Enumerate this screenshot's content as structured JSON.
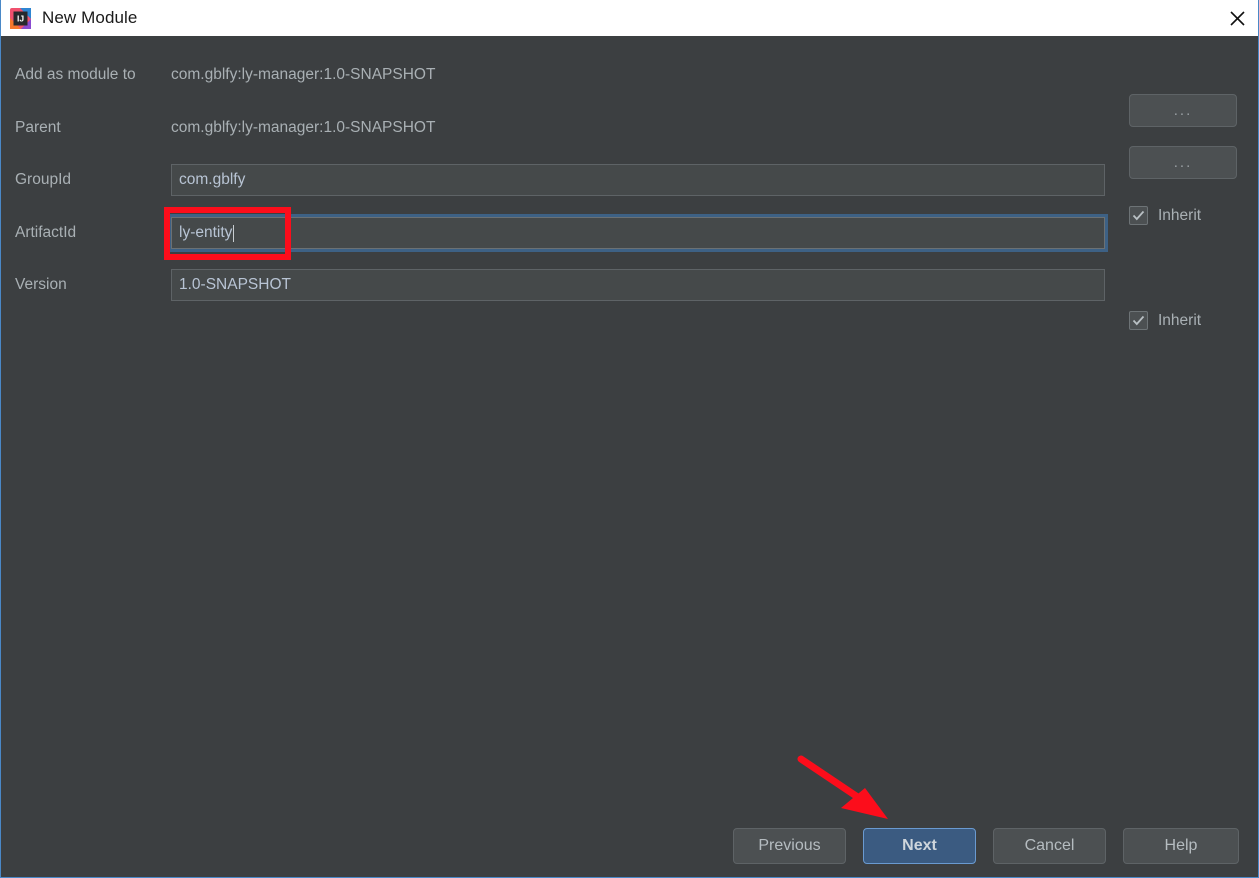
{
  "window": {
    "title": "New Module",
    "app_icon": "intellij-idea-logo-icon",
    "close_icon": "close-icon",
    "border_color": "#4a88c7",
    "background": "#3c3f41"
  },
  "form": {
    "rows": [
      {
        "label": "Add as module to",
        "type": "static",
        "value": "com.gblfy:ly-manager:1.0-SNAPSHOT"
      },
      {
        "label": "Parent",
        "type": "static",
        "value": "com.gblfy:ly-manager:1.0-SNAPSHOT"
      },
      {
        "label": "GroupId",
        "type": "input",
        "value": "com.gblfy"
      },
      {
        "label": "ArtifactId",
        "type": "input",
        "value": "ly-entity"
      },
      {
        "label": "Version",
        "type": "input",
        "value": "1.0-SNAPSHOT"
      }
    ],
    "browse_buttons": [
      {
        "label": "...",
        "icon": "ellipsis-icon"
      },
      {
        "label": "...",
        "icon": "ellipsis-icon"
      }
    ],
    "inherit_checkboxes": [
      {
        "label": "Inherit",
        "checked": true
      },
      {
        "label": "Inherit",
        "checked": true
      }
    ],
    "focused_field": "ArtifactId"
  },
  "footer": {
    "previous_label": "Previous",
    "next_label": "Next",
    "cancel_label": "Cancel",
    "help_label": "Help",
    "primary_color": "#3b5b81"
  },
  "annotations": {
    "highlight_color": "#fc0d1b",
    "rect_target": "artifactid-input",
    "arrow_target": "next-button"
  }
}
